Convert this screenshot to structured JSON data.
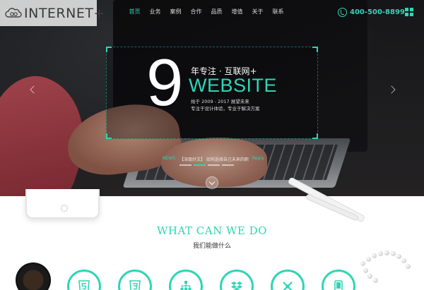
{
  "header": {
    "logo_text": "INTERNET+",
    "nav": [
      "首页",
      "业务",
      "案例",
      "合作",
      "品质",
      "增值",
      "关于",
      "联系"
    ],
    "active_index": 0,
    "phone": "400-500-8899",
    "accent": "#2fd5b5"
  },
  "hero": {
    "big_digit": "9",
    "sub": "年专注 · 互联网+",
    "title": "WEBSITE",
    "line1": "始于 2009 - 2017 展望未来",
    "line2": "专注于设计体验，专业于解决方案",
    "news_label": "NEWS",
    "news_text": "【深度好文】 如何选择自己未来的职",
    "news_tag": "Reply",
    "dots": 4,
    "active_dot": 1
  },
  "section": {
    "title": "WHAT CAN WE DO",
    "subtitle": "我们能做什么"
  },
  "services": [
    {
      "icon": "html5-icon"
    },
    {
      "icon": "css3-icon"
    },
    {
      "icon": "sitemap-icon"
    },
    {
      "icon": "dropbox-icon"
    },
    {
      "icon": "tools-icon"
    },
    {
      "icon": "mobile-icon"
    }
  ]
}
